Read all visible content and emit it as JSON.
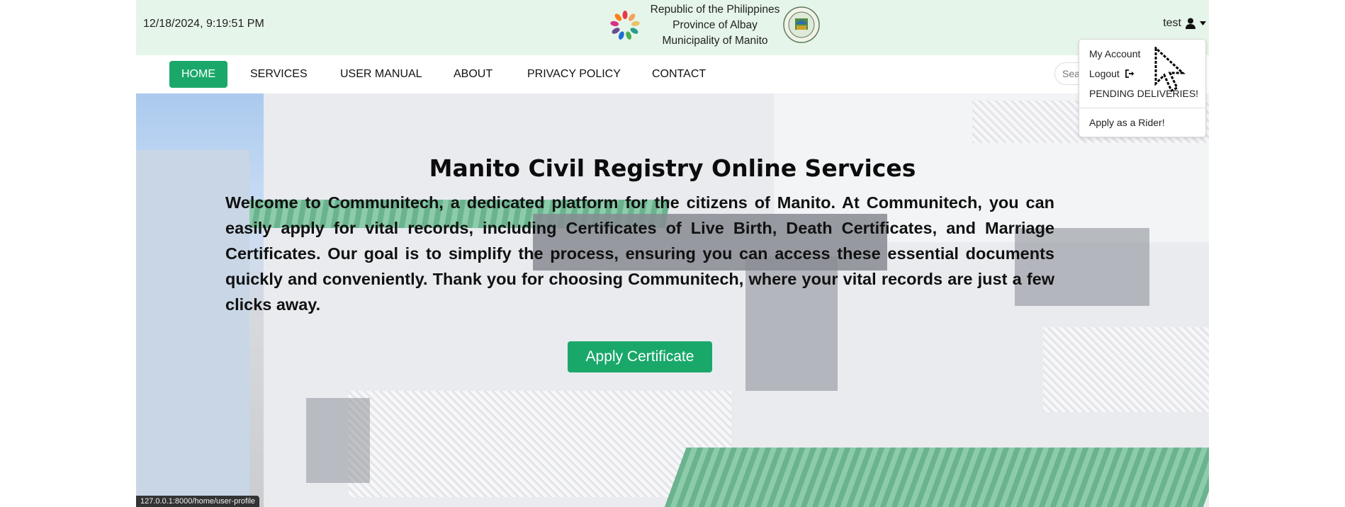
{
  "header": {
    "datetime": "12/18/2024, 9:19:51 PM",
    "gov_lines": [
      "Republic of the Philippines",
      "Province of Albay",
      "Municipality of Manito"
    ],
    "user_name": "test"
  },
  "nav": {
    "items": [
      "HOME",
      "SERVICES",
      "USER MANUAL",
      "ABOUT",
      "PRIVACY POLICY",
      "CONTACT"
    ],
    "search_placeholder": "Sea"
  },
  "hero": {
    "title": "Manito Civil Registry Online Services",
    "text": "Welcome to Communitech, a dedicated platform for the citizens of Manito. At Communitech, you can easily apply for vital records, including Certificates of Live Birth, Death Certificates, and Marriage Certificates. Our goal is to simplify the process, ensuring you can access these essential documents quickly and conveniently. Thank you for choosing Communitech, where your vital records are just a few clicks away.",
    "button": "Apply Certificate"
  },
  "user_dropdown": {
    "items": [
      "My Account",
      "Logout",
      "PENDING DELIVERIES!",
      "Apply as a Rider!"
    ]
  },
  "status_url": "127.0.0.1:8000/home/user-profile",
  "colors": {
    "accent": "#1aa86a",
    "header_bg": "#e6f5e9"
  },
  "icons": [
    "colorful-seal-icon",
    "municipal-seal-icon",
    "user-icon",
    "caret-down-icon",
    "logout-icon",
    "mouse-cursor-icon"
  ]
}
